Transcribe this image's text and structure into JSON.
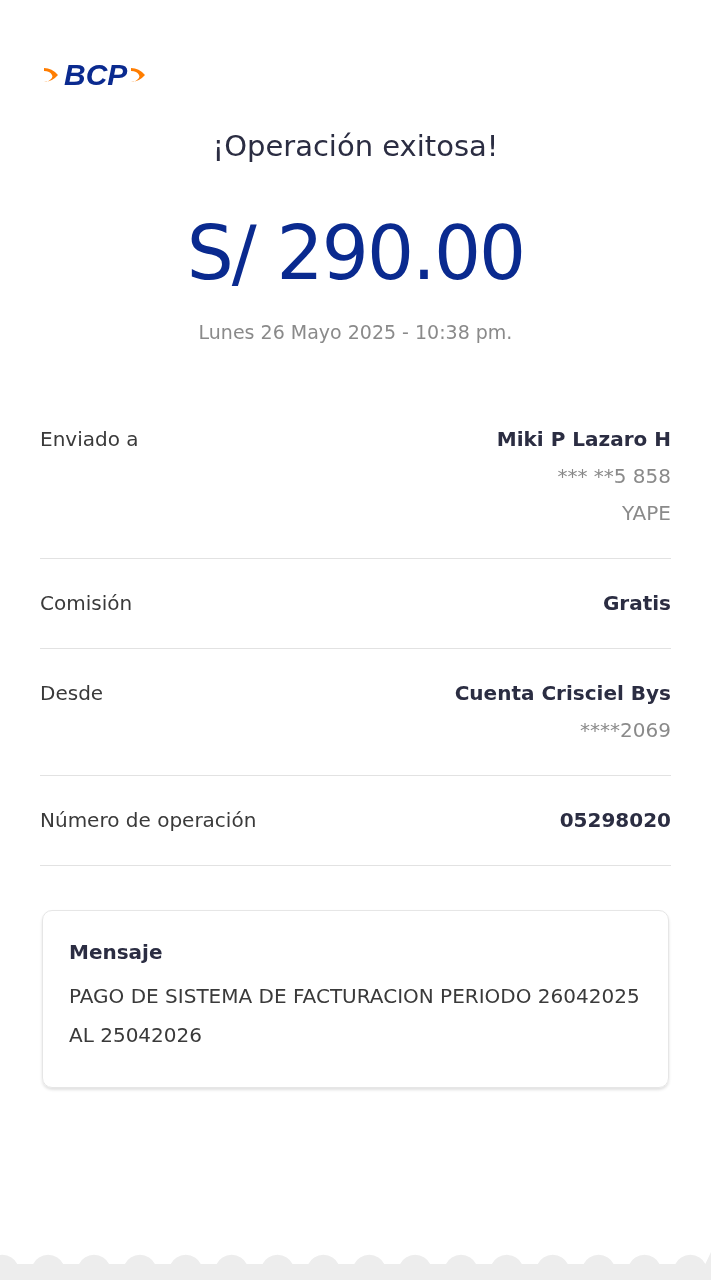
{
  "logo": {
    "text": "BCP"
  },
  "title": "¡Operación exitosa!",
  "amount": "S/ 290.00",
  "datetime": "Lunes 26 Mayo 2025 - 10:38 pm.",
  "details": [
    {
      "label": "Enviado a",
      "value": "Miki P Lazaro H",
      "extra": [
        "*** **5 858",
        "YAPE"
      ]
    },
    {
      "label": "Comisión",
      "value": "Gratis"
    },
    {
      "label": "Desde",
      "value": "Cuenta Crisciel Bys",
      "extra": [
        "****2069"
      ]
    },
    {
      "label": "Número de operación",
      "value": "05298020"
    }
  ],
  "message": {
    "heading": "Mensaje",
    "text": "PAGO DE SISTEMA DE FACTURACION PERIODO 26042025 AL 25042026"
  }
}
